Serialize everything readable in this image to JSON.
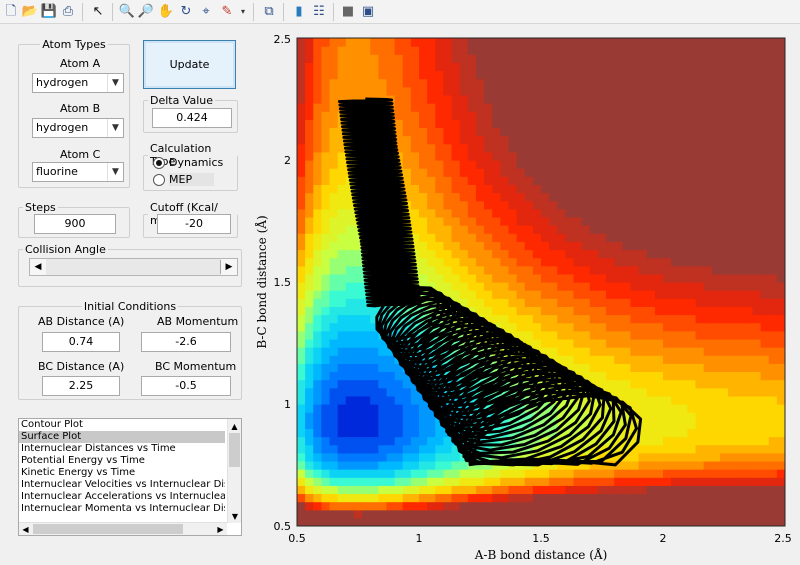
{
  "toolbar": {
    "icons": [
      "new-file-icon",
      "open-folder-icon",
      "save-icon",
      "print-icon",
      "pointer-icon",
      "zoom-in-icon",
      "zoom-out-icon",
      "pan-hand-icon",
      "rotate-3d-icon",
      "data-cursor-icon",
      "brush-icon",
      "link-plot-icon",
      "colorbar-icon",
      "legend-icon",
      "hide-plot-tools-icon",
      "show-plot-tools-icon"
    ]
  },
  "atom_types": {
    "title": "Atom Types",
    "atom_a": {
      "label": "Atom A",
      "value": "hydrogen"
    },
    "atom_b": {
      "label": "Atom B",
      "value": "hydrogen"
    },
    "atom_c": {
      "label": "Atom C",
      "value": "fluorine"
    }
  },
  "update_label": "Update",
  "delta": {
    "title": "Delta Value",
    "value": "0.424"
  },
  "calc_type": {
    "title": "Calculation Type",
    "opt1": "Dynamics",
    "opt2": "MEP",
    "selected": "Dynamics"
  },
  "steps": {
    "title": "Steps",
    "value": "900"
  },
  "cutoff": {
    "title": "Cutoff (Kcal/ mol)",
    "value": "-20"
  },
  "collision": {
    "title": "Collision Angle"
  },
  "initial": {
    "title": "Initial Conditions",
    "ab_dist_label": "AB Distance (A)",
    "ab_dist": "0.74",
    "ab_mom_label": "AB Momentum",
    "ab_mom": "-2.6",
    "bc_dist_label": "BC Distance (A)",
    "bc_dist": "2.25",
    "bc_mom_label": "BC Momentum",
    "bc_mom": "-0.5"
  },
  "plot_list": [
    "Contour Plot",
    "Surface Plot",
    "Internuclear Distances vs Time",
    "Potential Energy vs Time",
    "Kinetic Energy vs Time",
    "Internuclear Velocities vs Internuclear Distance",
    "Internuclear Accelerations vs Internuclear Distance",
    "Internuclear Momenta vs Internuclear Distance"
  ],
  "plot_selected": "Surface Plot",
  "chart_data": {
    "type": "heatmap",
    "xlabel": "A-B bond distance (Å)",
    "ylabel": "B-C bond distance (Å)",
    "xlim": [
      0.5,
      2.5
    ],
    "ylim": [
      0.5,
      2.5
    ],
    "xticks": [
      "0.5",
      "1",
      "1.5",
      "2",
      "2.5"
    ],
    "yticks": [
      "0.5",
      "1",
      "1.5",
      "2",
      "2.5"
    ],
    "colormap": [
      "#0000c8",
      "#0070ff",
      "#00c8ff",
      "#40ffd0",
      "#c8ff40",
      "#ffe000",
      "#ff8000",
      "#ff2000",
      "#9a3a34"
    ],
    "trajectory_color": "#000000"
  }
}
